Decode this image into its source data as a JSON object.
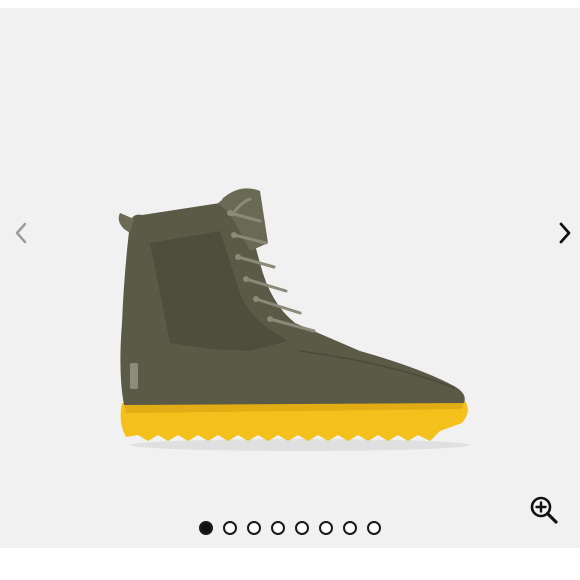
{
  "gallery": {
    "image_count": 8,
    "active_index": 0,
    "image_alt": "",
    "colors": {
      "stage_background": "#f1f1f1",
      "dot_active": "#111111",
      "dot_inactive_border": "#1a1a1a",
      "boot_upper": "#5b5a47",
      "boot_sole": "#f3c01c"
    }
  },
  "icons": {
    "prev": "chevron-left-icon",
    "next": "chevron-right-icon",
    "zoom": "zoom-in-icon"
  }
}
